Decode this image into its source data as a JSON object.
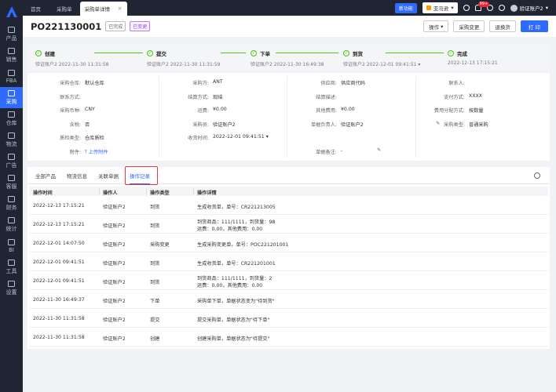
{
  "sidebar": {
    "items": [
      {
        "label": "产品",
        "icon": "box-icon"
      },
      {
        "label": "销售",
        "icon": "shop-icon"
      },
      {
        "label": "FBA",
        "icon": "warehouse-icon"
      },
      {
        "label": "采购",
        "icon": "cart-icon",
        "active": true
      },
      {
        "label": "仓库",
        "icon": "home-icon"
      },
      {
        "label": "物流",
        "icon": "truck-icon"
      },
      {
        "label": "广告",
        "icon": "megaphone-icon"
      },
      {
        "label": "客服",
        "icon": "chat-icon"
      },
      {
        "label": "财务",
        "icon": "money-icon"
      },
      {
        "label": "统计",
        "icon": "chart-icon"
      },
      {
        "label": "BI",
        "icon": "bi-icon"
      },
      {
        "label": "工具",
        "icon": "tool-icon"
      },
      {
        "label": "设置",
        "icon": "gear-icon"
      }
    ]
  },
  "topbar": {
    "tabs": [
      "首页",
      "采购单",
      "采购单详情"
    ],
    "close": "×",
    "news": "新功能",
    "store": "亚马逊",
    "store_caret": "▾",
    "notif_count": "99+",
    "user": "验证账户2",
    "user_caret": "▾"
  },
  "header": {
    "po": "PO221130001",
    "tag1": "已完成",
    "tag2": "已变更",
    "buttons": {
      "ops": "操作",
      "ops_caret": "▾",
      "change": "采购变更",
      "return": "退换货",
      "print": "打 印"
    }
  },
  "steps": [
    {
      "title": "创建",
      "user": "验证账户2",
      "time": "2022-11-30 11:31:58"
    },
    {
      "title": "提交",
      "user": "验证账户2",
      "time": "2022-11-30 11:31:59"
    },
    {
      "title": "下单",
      "user": "验证账户2",
      "time": "2022-11-30 16:49:38"
    },
    {
      "title": "到货",
      "user": "验证账户2",
      "time": "2022-12-01 09:41:51",
      "caret": "▾"
    },
    {
      "title": "完成",
      "user": "",
      "time": "2022-12-13 17:15:21"
    }
  ],
  "info": {
    "c1": [
      {
        "k": "采购仓库:",
        "v": "默认仓库"
      },
      {
        "k": "联系方式:",
        "v": ""
      },
      {
        "k": "采购币种:",
        "v": "CNY"
      },
      {
        "k": "含税:",
        "v": "否"
      },
      {
        "k": "质检类型:",
        "v": "仓库质检"
      },
      {
        "k": "附件:",
        "v": "上传附件"
      }
    ],
    "c2": [
      {
        "k": "采购方:",
        "v": "ANT"
      },
      {
        "k": "结算方式:",
        "v": "现结"
      },
      {
        "k": "运费:",
        "v": "¥0.00"
      },
      {
        "k": "采购员:",
        "v": "验证账户2"
      },
      {
        "k": "收货时间:",
        "v": "2022-12-01 09:41:51",
        "caret": "▾"
      }
    ],
    "c3": [
      {
        "k": "供应商:",
        "v": "供应商代码"
      },
      {
        "k": "结算描述:",
        "v": ""
      },
      {
        "k": "其他费用:",
        "v": "¥0.00"
      },
      {
        "k": "单据负责人:",
        "v": "验证账户2"
      },
      {
        "k": "",
        "v": ""
      },
      {
        "k": "单据备注:",
        "v": "-"
      }
    ],
    "c4": [
      {
        "k": "联系人:",
        "v": ""
      },
      {
        "k": "支付方式:",
        "v": "XXXX"
      },
      {
        "k": "费用分配方式:",
        "v": "按数量"
      },
      {
        "k": "采购类型:",
        "v": "普通采购"
      }
    ]
  },
  "detail_tabs": [
    "全部产品",
    "物流信息",
    "关联单据",
    "操作记录"
  ],
  "log": {
    "headers": [
      "操作时间",
      "操作人",
      "操作类型",
      "操作详情"
    ],
    "rows": [
      {
        "time": "2022-12-13 17:15:21",
        "user": "验证账户2",
        "type": "到货",
        "detail": "生成收货单，单号：CR221213005",
        "detail2": ""
      },
      {
        "time": "2022-12-13 17:15:21",
        "user": "验证账户2",
        "type": "到货",
        "detail": "到货商品：111/1111，到货量：98",
        "detail2": "运费：0.00，其他费用：0.00"
      },
      {
        "time": "2022-12-01 14:07:50",
        "user": "验证账户2",
        "type": "采购变更",
        "detail": "生成采购变更单，单号：POC221201001",
        "detail2": ""
      },
      {
        "time": "2022-12-01 09:41:51",
        "user": "验证账户2",
        "type": "到货",
        "detail": "生成收货单，单号：CR221201001",
        "detail2": ""
      },
      {
        "time": "2022-12-01 09:41:51",
        "user": "验证账户2",
        "type": "到货",
        "detail": "到货商品：111/1111，到货量：2",
        "detail2": "运费：0.00，其他费用：0.00"
      },
      {
        "time": "2022-11-30 16:49:37",
        "user": "验证账户2",
        "type": "下单",
        "detail": "采购单下单，单据状态变为\"待到货\"",
        "detail2": ""
      },
      {
        "time": "2022-11-30 11:31:58",
        "user": "验证账户2",
        "type": "提交",
        "detail": "提交采购单，单据状态为\"待下单\"",
        "detail2": ""
      },
      {
        "time": "2022-11-30 11:31:58",
        "user": "验证账户2",
        "type": "创建",
        "detail": "创建采购单，单据状态为\"待提交\"",
        "detail2": ""
      }
    ]
  },
  "colors": {
    "primary": "#2f6bff",
    "sidebar": "#1f2533",
    "success": "#52c41a",
    "highlight": "#e53935"
  }
}
